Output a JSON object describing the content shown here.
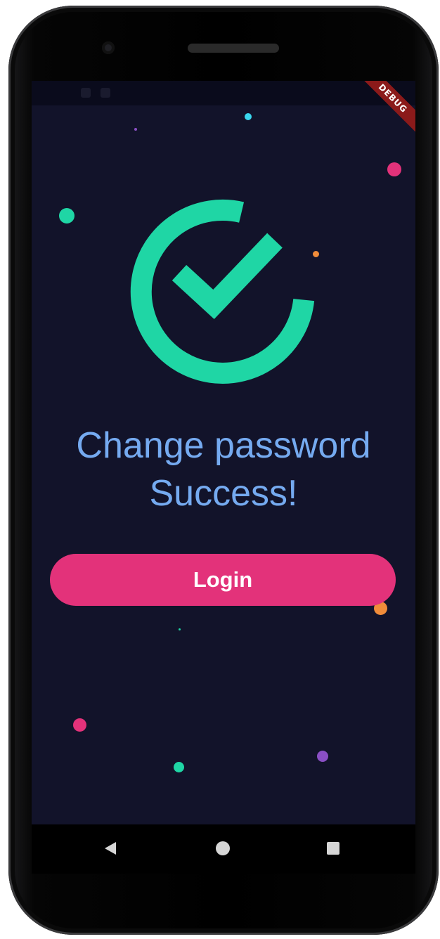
{
  "debug_banner": "DEBUG",
  "success": {
    "icon": "check-circle-icon",
    "title_line1": "Change password",
    "title_line2": "Success!"
  },
  "login_button": {
    "label": "Login"
  },
  "navigation": {
    "back": "back-triangle-icon",
    "home": "home-circle-icon",
    "recents": "recents-square-icon"
  },
  "colors": {
    "background": "#12132a",
    "accent_green": "#1fd6a5",
    "title_blue": "#75aaf0",
    "button_pink": "#e3327a"
  }
}
